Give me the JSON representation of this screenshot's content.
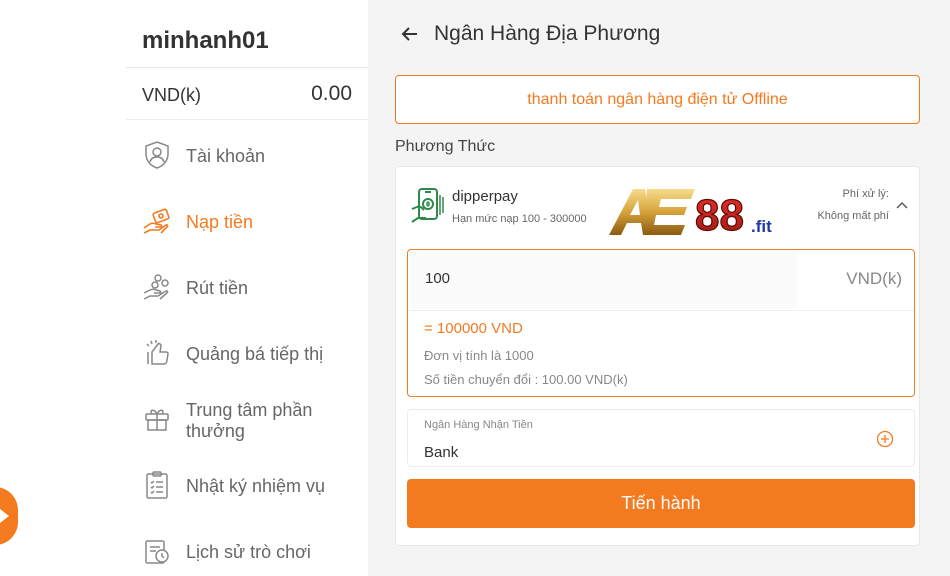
{
  "sidebar": {
    "username": "minhanh01",
    "balance": {
      "currency": "VND(k)",
      "value": "0.00"
    },
    "items": [
      {
        "label": "Tài khoản",
        "icon": "shield-user-icon",
        "active": false
      },
      {
        "label": "Nạp tiền",
        "icon": "deposit-hand-icon",
        "active": true
      },
      {
        "label": "Rút tiền",
        "icon": "withdraw-hand-coins-icon",
        "active": false
      },
      {
        "label": "Quảng bá tiếp thị",
        "icon": "thumbs-up-icon",
        "active": false
      },
      {
        "label": "Trung tâm phần thưởng",
        "icon": "gift-icon",
        "active": false
      },
      {
        "label": "Nhật ký nhiệm vụ",
        "icon": "clipboard-list-icon",
        "active": false
      },
      {
        "label": "Lịch sử trò chơi",
        "icon": "history-icon",
        "active": false
      }
    ]
  },
  "main": {
    "title": "Ngân Hàng Địa Phương",
    "tab_label": "thanh toán ngân hàng điện tử Offline",
    "method_label": "Phương Thức",
    "payment": {
      "name": "dipperpay",
      "limit": "Hạn mức nạp 100 - 300000",
      "fee_label": "Phí xử lý:",
      "fee_value": "Không mất phí",
      "logo_text": "AE88",
      "logo_suffix": ".fit"
    },
    "amount": {
      "value": "100",
      "unit": "VND(k)",
      "converted": "= 100000 VND",
      "unit_note": "Đơn vị tính là 1000",
      "exchange": "Số tiền chuyển đổi : 100.00 VND(k)"
    },
    "bank": {
      "label": "Ngân Hàng Nhận Tiền",
      "value": "Bank"
    },
    "submit_label": "Tiến hành"
  },
  "colors": {
    "accent": "#f47a20",
    "main_bg": "#f4f4f4",
    "pay_icon": "#2f8a4a"
  }
}
